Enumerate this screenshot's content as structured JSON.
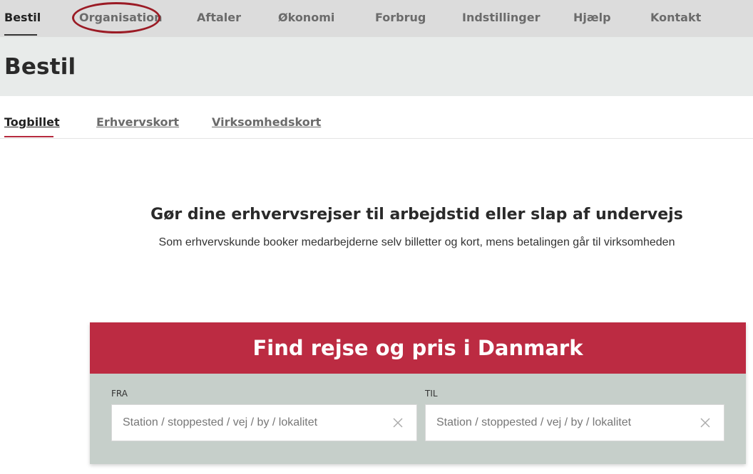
{
  "topnav": {
    "items": [
      {
        "label": "Bestil"
      },
      {
        "label": "Organisation"
      },
      {
        "label": "Aftaler"
      },
      {
        "label": "Økonomi"
      },
      {
        "label": "Forbrug"
      },
      {
        "label": "Indstillinger"
      },
      {
        "label": "Hjælp"
      },
      {
        "label": "Kontakt"
      }
    ],
    "active_color": "#333333",
    "annotation_color": "#9b1b25"
  },
  "page": {
    "title": "Bestil"
  },
  "subtabs": {
    "items": [
      {
        "label": "Togbillet"
      },
      {
        "label": "Erhvervskort"
      },
      {
        "label": "Virksomhedskort"
      }
    ],
    "accent_color": "#b62a3e"
  },
  "intro": {
    "title": "Gør dine erhvervsrejser til arbejdstid eller slap af undervejs",
    "subtitle": "Som erhvervskunde booker medarbejderne selv billetter og kort, mens betalingen går til virksomheden"
  },
  "search": {
    "title": "Find rejse og pris i Danmark",
    "header_color": "#bc2b42",
    "body_color": "#c6cfca",
    "from": {
      "label": "FRA",
      "placeholder": "Station / stoppested / vej / by / lokalitet",
      "value": ""
    },
    "to": {
      "label": "TIL",
      "placeholder": "Station / stoppested / vej / by / lokalitet",
      "value": ""
    },
    "clear_icon": "close-icon"
  }
}
